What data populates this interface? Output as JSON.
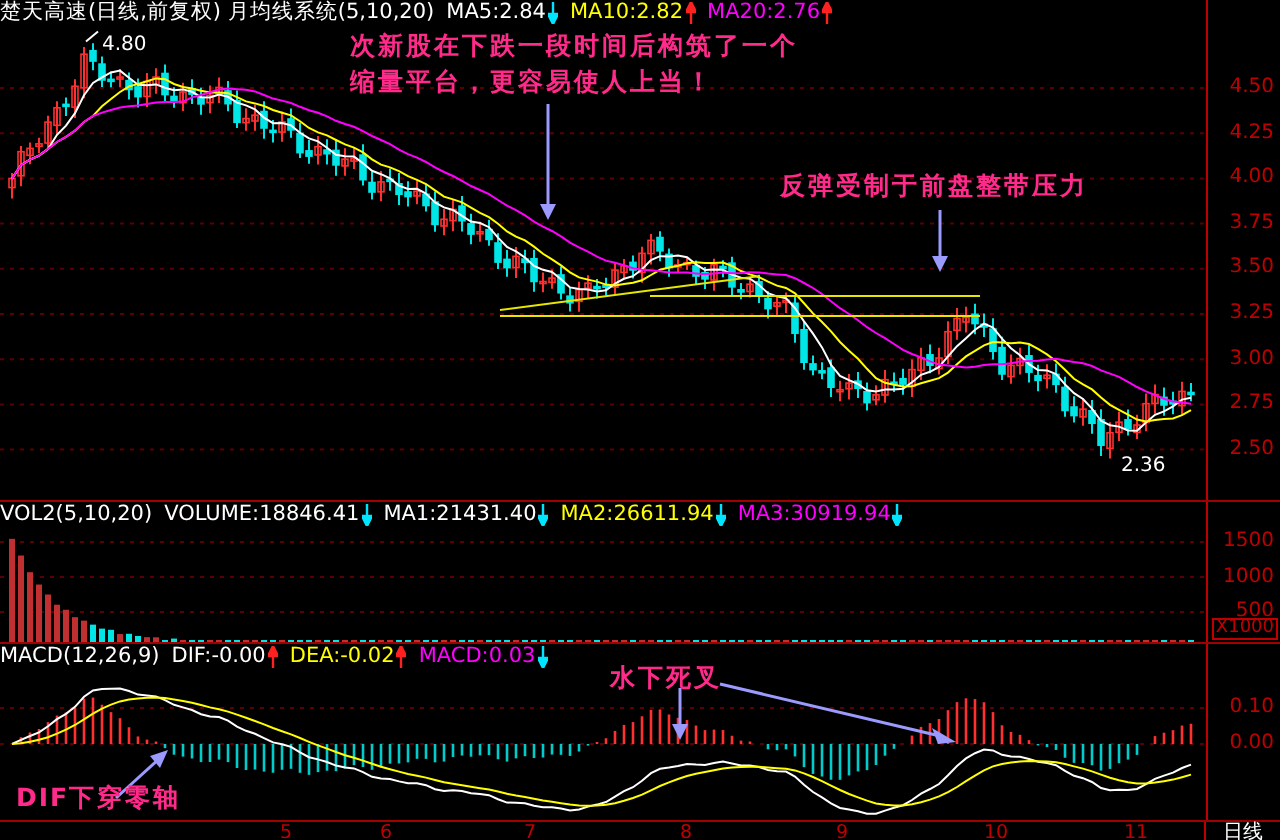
{
  "header": {
    "title": "楚天高速(日线,前复权) 月均线系统(5,10,20)",
    "indicators": [
      {
        "label": "MA5:2.84",
        "color": "#ffffff",
        "rising": false
      },
      {
        "label": "MA10:2.82",
        "color": "#ffff00",
        "rising": true
      },
      {
        "label": "MA20:2.76",
        "color": "#ff00ff",
        "rising": true
      }
    ]
  },
  "price_chart": {
    "high_label": "4.80",
    "low_label": "2.36",
    "axis_labels": [
      "4.50",
      "4.25",
      "4.00",
      "3.75",
      "3.50",
      "3.25",
      "3.00",
      "2.75",
      "2.50"
    ],
    "notes": [
      {
        "text": "次新股在下跌一段时间后构筑了一个缩量平台，更容易使人上当！"
      },
      {
        "text": "反弹受制于前盘整带压力"
      }
    ]
  },
  "volume_panel": {
    "title": "VOL2(5,10,20)",
    "indicators": [
      {
        "label": "VOLUME:18846.41",
        "color": "#ffffff",
        "rising": false
      },
      {
        "label": "MA1:21431.40",
        "color": "#ffffff",
        "rising": false
      },
      {
        "label": "MA2:26611.94",
        "color": "#ffff00",
        "rising": false
      },
      {
        "label": "MA3:30919.94",
        "color": "#ff00ff",
        "rising": false
      }
    ],
    "axis_labels": [
      "1500",
      "1000",
      "500"
    ],
    "unit": "X1000"
  },
  "macd_panel": {
    "title": "MACD(12,26,9)",
    "indicators": [
      {
        "label": "DIF:-0.00",
        "color": "#ffffff",
        "rising": true
      },
      {
        "label": "DEA:-0.02",
        "color": "#ffff00",
        "rising": true
      },
      {
        "label": "MACD:0.03",
        "color": "#ff00ff",
        "rising": false
      }
    ],
    "axis_labels": [
      "0.10",
      "0.00"
    ],
    "notes": [
      {
        "text": "水下死叉"
      },
      {
        "text": "DIF下穿零轴"
      }
    ]
  },
  "time_axis": {
    "months": [
      "5",
      "6",
      "7",
      "8",
      "9",
      "10",
      "11"
    ],
    "period": "日线"
  }
}
